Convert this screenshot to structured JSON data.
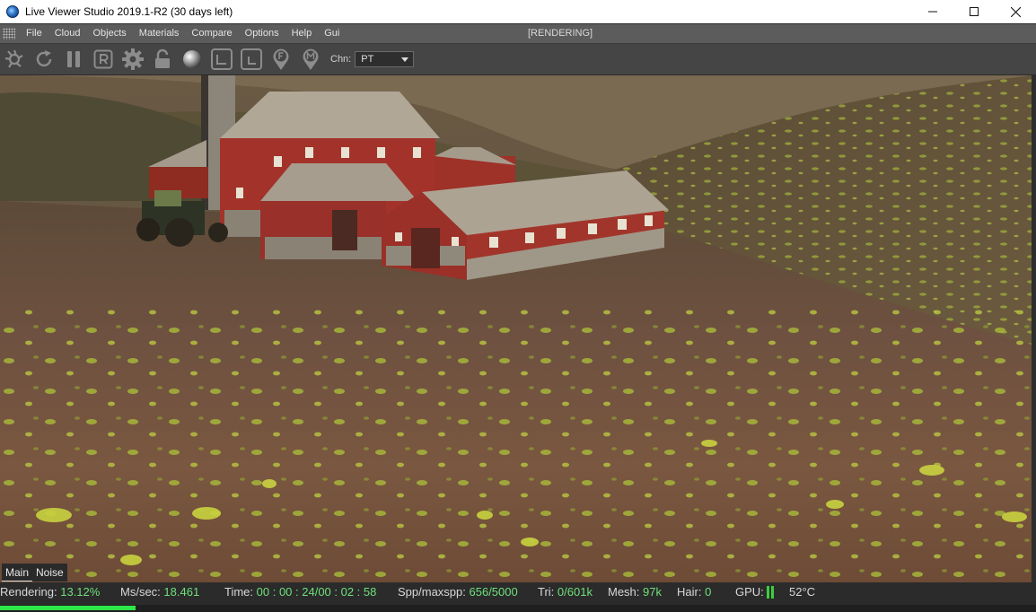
{
  "window": {
    "title": "Live Viewer Studio 2019.1-R2 (30 days left)"
  },
  "menu": {
    "items": [
      "File",
      "Cloud",
      "Objects",
      "Materials",
      "Compare",
      "Options",
      "Help",
      "Gui"
    ],
    "status": "[RENDERING]"
  },
  "toolbar": {
    "icons": [
      "aperture-icon",
      "refresh-icon",
      "pause-icon",
      "r-icon",
      "gear-icon",
      "lock-icon",
      "sphere-icon",
      "region-icon",
      "region-small-icon",
      "focus-pin-icon",
      "material-pin-icon"
    ],
    "chn_label": "Chn:",
    "chn_value": "PT"
  },
  "viewport_tabs": [
    "Main",
    "Noise"
  ],
  "status": {
    "rendering_label": "Rendering:",
    "rendering_value": "13.12%",
    "mssec_label": "Ms/sec:",
    "mssec_value": "18.461",
    "time_label": "Time:",
    "time_value": "00 : 00 : 24/00 : 02 : 58",
    "spp_label": "Spp/maxspp:",
    "spp_value": "656/5000",
    "tri_label": "Tri:",
    "tri_value": "0/601k",
    "mesh_label": "Mesh:",
    "mesh_value": "97k",
    "hair_label": "Hair:",
    "hair_value": "0",
    "gpu_label": "GPU:",
    "temp_value": "52°C",
    "progress": 0.1312
  },
  "colors": {
    "accent_green": "#6fe07a",
    "progress_green": "#2fe64a"
  }
}
